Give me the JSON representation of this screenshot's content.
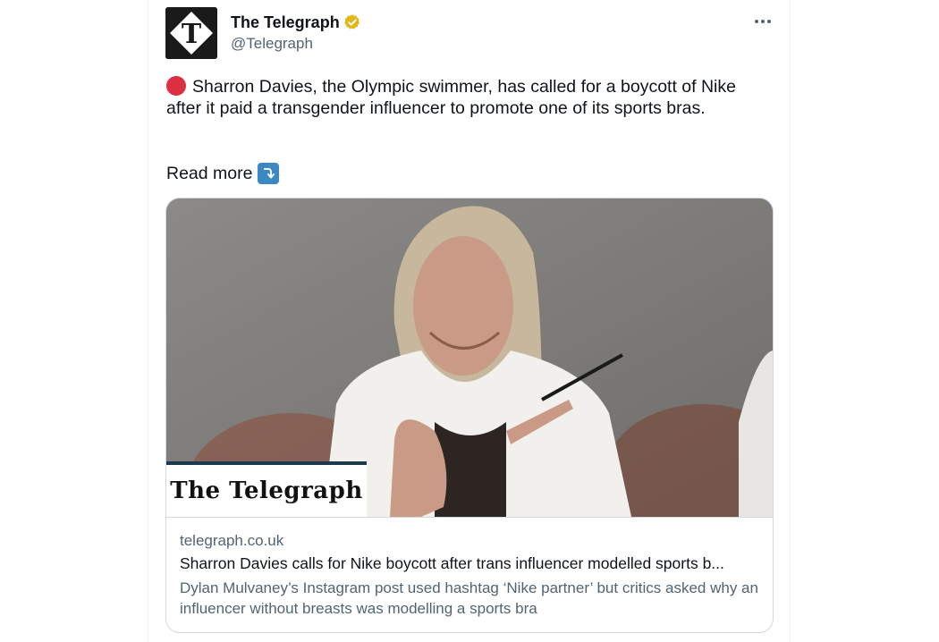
{
  "author": {
    "display_name": "The Telegraph",
    "handle": "@Telegraph",
    "avatar_icon": "telegraph-t-logo-icon",
    "verified_icon": "verified-badge-icon",
    "verified_color": "#e2b719"
  },
  "menu": {
    "icon": "more-options-icon"
  },
  "tweet": {
    "emoji": "red-circle-icon",
    "emoji_color": "#dd2e44",
    "text": "Sharron Davies, the Olympic swimmer, has called for a boycott of Nike after it paid a transgender influencer to promote one of its sports bras.",
    "read_more": "Read more",
    "read_more_icon": "right-arrow-curving-down-icon",
    "read_more_icon_color": "#3b88c3"
  },
  "card": {
    "image_brand": "The Telegraph",
    "domain": "telegraph.co.uk",
    "title": "Sharron Davies calls for Nike boycott after trans influencer modelled sports b...",
    "description": "Dylan Mulvaney’s Instagram post used hashtag ‘Nike partner’ but critics asked why an influencer without breasts was modelling a sports bra"
  }
}
